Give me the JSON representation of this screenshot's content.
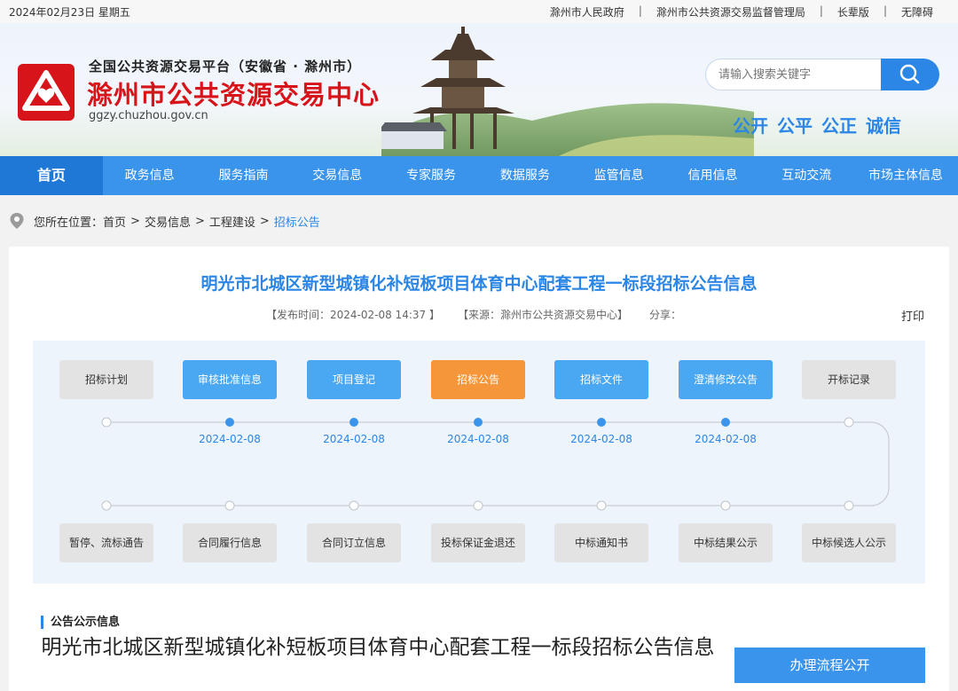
{
  "topbar": {
    "date": "2024年02月23日  星期五",
    "links": [
      "滁州市人民政府",
      "滁州市公共资源交易监督管理局",
      "长辈版",
      "无障碍"
    ]
  },
  "header": {
    "slogan": "全国公共资源交易平台（安徽省 · 滁州市）",
    "site_name": "滁州市公共资源交易中心",
    "domain": "ggzy.chuzhou.gov.cn",
    "search_placeholder": "请输入搜索关键字",
    "values": [
      "公开",
      "公平",
      "公正",
      "诚信"
    ],
    "brand_color": "#d7141a",
    "accent_color": "#2b86e5"
  },
  "nav": {
    "items": [
      "首页",
      "政务信息",
      "服务指南",
      "交易信息",
      "专家服务",
      "数据服务",
      "监管信息",
      "信用信息",
      "互动交流",
      "市场主体信息"
    ],
    "active": "首页"
  },
  "breadcrumb": {
    "prefix": "您所在位置：",
    "items": [
      "首页",
      "交易信息",
      "工程建设"
    ],
    "current": "招标公告"
  },
  "article": {
    "title": "明光市北城区新型城镇化补短板项目体育中心配套工程一标段招标公告信息",
    "publish_time": "【发布时间：2024-02-08 14:37 】",
    "source": "【来源：滁州市公共资源交易中心】",
    "share": "分享：",
    "print": "打印"
  },
  "flow": {
    "top_steps": [
      {
        "label": "招标计划",
        "state": "off",
        "date": ""
      },
      {
        "label": "审核批准信息",
        "state": "on",
        "date": "2024-02-08"
      },
      {
        "label": "项目登记",
        "state": "on",
        "date": "2024-02-08"
      },
      {
        "label": "招标公告",
        "state": "current",
        "date": "2024-02-08"
      },
      {
        "label": "招标文件",
        "state": "on",
        "date": "2024-02-08"
      },
      {
        "label": "澄清修改公告",
        "state": "on",
        "date": "2024-02-08"
      },
      {
        "label": "开标记录",
        "state": "off",
        "date": ""
      }
    ],
    "bottom_steps": [
      {
        "label": "暂停、流标通告",
        "state": "off"
      },
      {
        "label": "合同履行信息",
        "state": "off"
      },
      {
        "label": "合同订立信息",
        "state": "off"
      },
      {
        "label": "投标保证金退还",
        "state": "off"
      },
      {
        "label": "中标通知书",
        "state": "off"
      },
      {
        "label": "中标结果公示",
        "state": "off"
      },
      {
        "label": "中标候选人公示",
        "state": "off"
      }
    ]
  },
  "notice": {
    "section_label": "公告公示信息",
    "doc_title": "明光市北城区新型城镇化补短板项目体育中心配套工程一标段招标公告信息"
  },
  "sidebar": {
    "box_title": "办理流程公开"
  }
}
